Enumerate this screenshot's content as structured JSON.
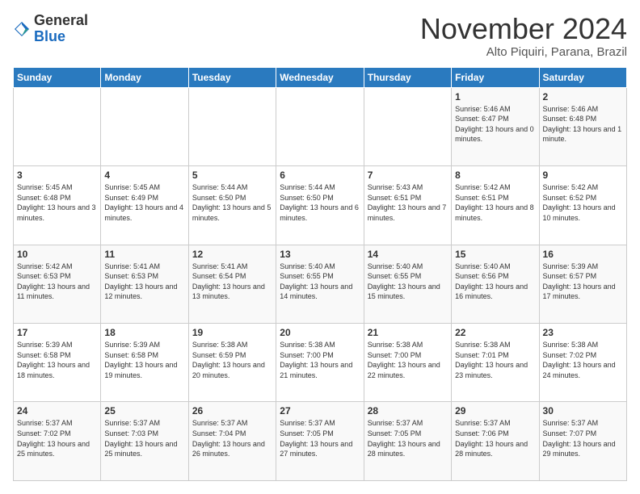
{
  "logo": {
    "general": "General",
    "blue": "Blue"
  },
  "header": {
    "title": "November 2024",
    "subtitle": "Alto Piquiri, Parana, Brazil"
  },
  "weekdays": [
    "Sunday",
    "Monday",
    "Tuesday",
    "Wednesday",
    "Thursday",
    "Friday",
    "Saturday"
  ],
  "weeks": [
    [
      {
        "day": "",
        "info": ""
      },
      {
        "day": "",
        "info": ""
      },
      {
        "day": "",
        "info": ""
      },
      {
        "day": "",
        "info": ""
      },
      {
        "day": "",
        "info": ""
      },
      {
        "day": "1",
        "info": "Sunrise: 5:46 AM\nSunset: 6:47 PM\nDaylight: 13 hours and 0 minutes."
      },
      {
        "day": "2",
        "info": "Sunrise: 5:46 AM\nSunset: 6:48 PM\nDaylight: 13 hours and 1 minute."
      }
    ],
    [
      {
        "day": "3",
        "info": "Sunrise: 5:45 AM\nSunset: 6:48 PM\nDaylight: 13 hours and 3 minutes."
      },
      {
        "day": "4",
        "info": "Sunrise: 5:45 AM\nSunset: 6:49 PM\nDaylight: 13 hours and 4 minutes."
      },
      {
        "day": "5",
        "info": "Sunrise: 5:44 AM\nSunset: 6:50 PM\nDaylight: 13 hours and 5 minutes."
      },
      {
        "day": "6",
        "info": "Sunrise: 5:44 AM\nSunset: 6:50 PM\nDaylight: 13 hours and 6 minutes."
      },
      {
        "day": "7",
        "info": "Sunrise: 5:43 AM\nSunset: 6:51 PM\nDaylight: 13 hours and 7 minutes."
      },
      {
        "day": "8",
        "info": "Sunrise: 5:42 AM\nSunset: 6:51 PM\nDaylight: 13 hours and 8 minutes."
      },
      {
        "day": "9",
        "info": "Sunrise: 5:42 AM\nSunset: 6:52 PM\nDaylight: 13 hours and 10 minutes."
      }
    ],
    [
      {
        "day": "10",
        "info": "Sunrise: 5:42 AM\nSunset: 6:53 PM\nDaylight: 13 hours and 11 minutes."
      },
      {
        "day": "11",
        "info": "Sunrise: 5:41 AM\nSunset: 6:53 PM\nDaylight: 13 hours and 12 minutes."
      },
      {
        "day": "12",
        "info": "Sunrise: 5:41 AM\nSunset: 6:54 PM\nDaylight: 13 hours and 13 minutes."
      },
      {
        "day": "13",
        "info": "Sunrise: 5:40 AM\nSunset: 6:55 PM\nDaylight: 13 hours and 14 minutes."
      },
      {
        "day": "14",
        "info": "Sunrise: 5:40 AM\nSunset: 6:55 PM\nDaylight: 13 hours and 15 minutes."
      },
      {
        "day": "15",
        "info": "Sunrise: 5:40 AM\nSunset: 6:56 PM\nDaylight: 13 hours and 16 minutes."
      },
      {
        "day": "16",
        "info": "Sunrise: 5:39 AM\nSunset: 6:57 PM\nDaylight: 13 hours and 17 minutes."
      }
    ],
    [
      {
        "day": "17",
        "info": "Sunrise: 5:39 AM\nSunset: 6:58 PM\nDaylight: 13 hours and 18 minutes."
      },
      {
        "day": "18",
        "info": "Sunrise: 5:39 AM\nSunset: 6:58 PM\nDaylight: 13 hours and 19 minutes."
      },
      {
        "day": "19",
        "info": "Sunrise: 5:38 AM\nSunset: 6:59 PM\nDaylight: 13 hours and 20 minutes."
      },
      {
        "day": "20",
        "info": "Sunrise: 5:38 AM\nSunset: 7:00 PM\nDaylight: 13 hours and 21 minutes."
      },
      {
        "day": "21",
        "info": "Sunrise: 5:38 AM\nSunset: 7:00 PM\nDaylight: 13 hours and 22 minutes."
      },
      {
        "day": "22",
        "info": "Sunrise: 5:38 AM\nSunset: 7:01 PM\nDaylight: 13 hours and 23 minutes."
      },
      {
        "day": "23",
        "info": "Sunrise: 5:38 AM\nSunset: 7:02 PM\nDaylight: 13 hours and 24 minutes."
      }
    ],
    [
      {
        "day": "24",
        "info": "Sunrise: 5:37 AM\nSunset: 7:02 PM\nDaylight: 13 hours and 25 minutes."
      },
      {
        "day": "25",
        "info": "Sunrise: 5:37 AM\nSunset: 7:03 PM\nDaylight: 13 hours and 25 minutes."
      },
      {
        "day": "26",
        "info": "Sunrise: 5:37 AM\nSunset: 7:04 PM\nDaylight: 13 hours and 26 minutes."
      },
      {
        "day": "27",
        "info": "Sunrise: 5:37 AM\nSunset: 7:05 PM\nDaylight: 13 hours and 27 minutes."
      },
      {
        "day": "28",
        "info": "Sunrise: 5:37 AM\nSunset: 7:05 PM\nDaylight: 13 hours and 28 minutes."
      },
      {
        "day": "29",
        "info": "Sunrise: 5:37 AM\nSunset: 7:06 PM\nDaylight: 13 hours and 28 minutes."
      },
      {
        "day": "30",
        "info": "Sunrise: 5:37 AM\nSunset: 7:07 PM\nDaylight: 13 hours and 29 minutes."
      }
    ]
  ]
}
